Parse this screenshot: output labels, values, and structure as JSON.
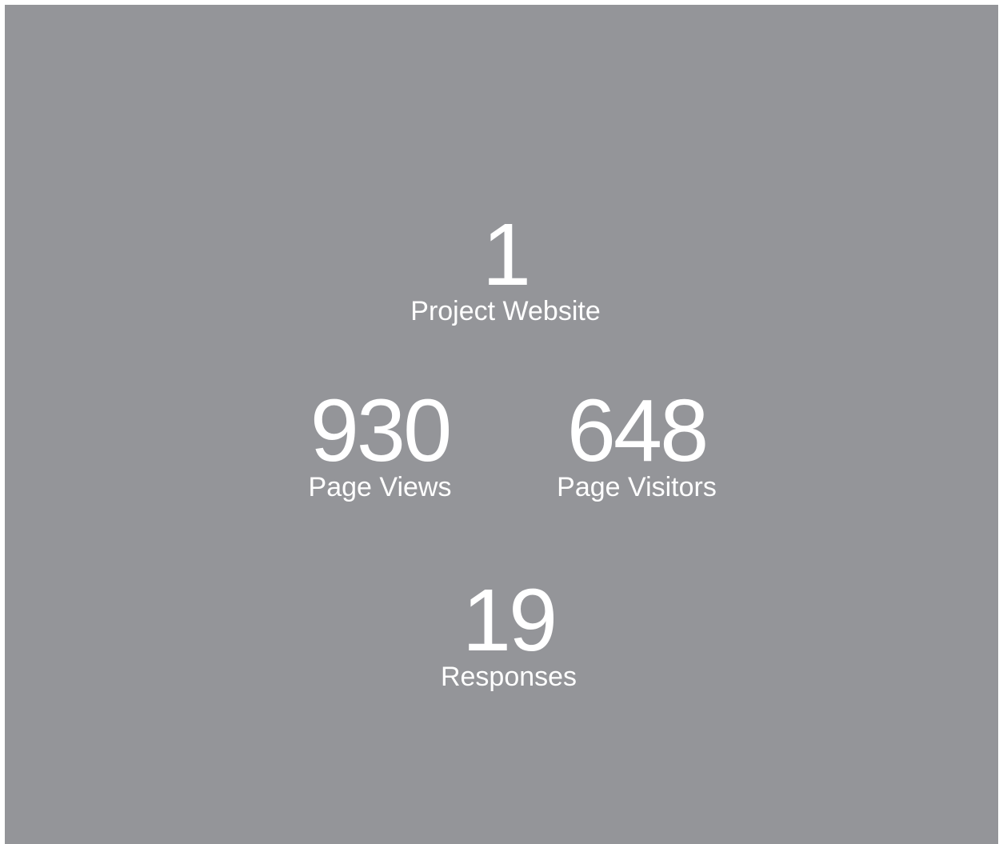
{
  "stats": {
    "project_website": {
      "value": "1",
      "label": "Project Website"
    },
    "page_views": {
      "value": "930",
      "label": "Page Views"
    },
    "page_visitors": {
      "value": "648",
      "label": "Page Visitors"
    },
    "responses": {
      "value": "19",
      "label": "Responses"
    }
  },
  "colors": {
    "panel_background": "#949599",
    "text": "#ffffff"
  }
}
